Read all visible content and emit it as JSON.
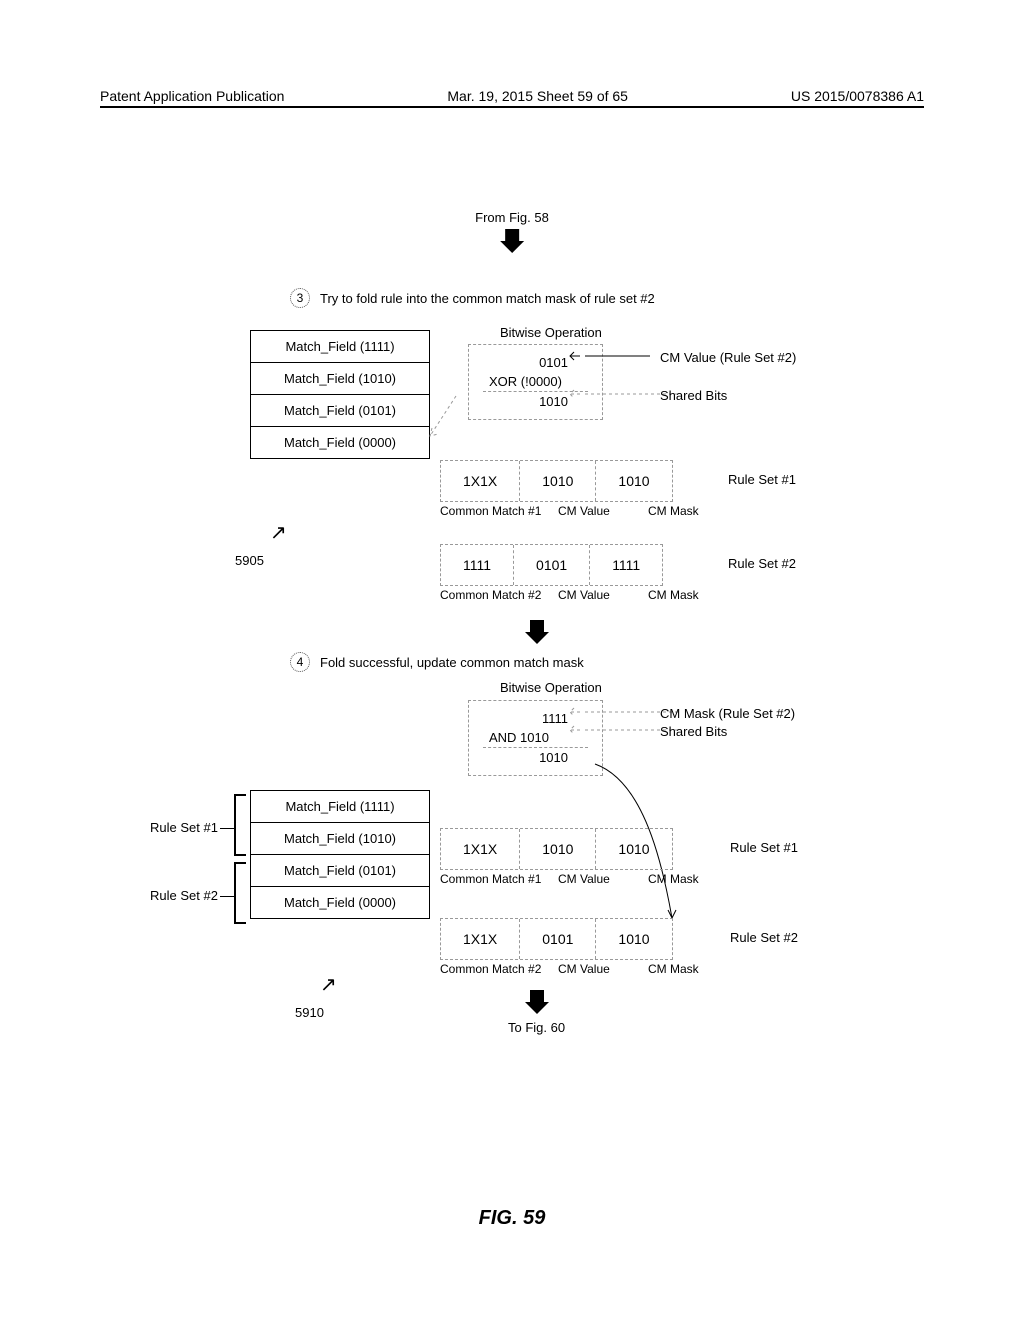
{
  "header": {
    "left": "Patent Application Publication",
    "mid": "Mar. 19, 2015  Sheet 59 of 65",
    "right": "US 2015/0078386 A1"
  },
  "from_label": "From Fig. 58",
  "step3": {
    "num": "3",
    "text": "Try to fold rule into the common match mask of rule set #2"
  },
  "step4": {
    "num": "4",
    "text": "Fold successful, update common match mask"
  },
  "match_fields_3": [
    "Match_Field (1111)",
    "Match_Field (1010)",
    "Match_Field (0101)",
    "Match_Field (0000)"
  ],
  "match_fields_4": [
    "Match_Field (1111)",
    "Match_Field (1010)",
    "Match_Field (0101)",
    "Match_Field (0000)"
  ],
  "bitop_title": "Bitwise Operation",
  "bitop3": {
    "line1": "0101",
    "op": "XOR (!0000)",
    "res": "1010",
    "note1": "CM Value (Rule Set #2)",
    "note2": "Shared Bits"
  },
  "bitop4": {
    "line1": "1111",
    "op": "AND 1010",
    "res": "1010",
    "note1": "CM Mask  (Rule Set #2)",
    "note2": "Shared Bits"
  },
  "sets3": {
    "row1": {
      "cm": "1X1X",
      "val": "1010",
      "mask": "1010",
      "label": "Rule Set #1"
    },
    "row2": {
      "cm": "1111",
      "val": "0101",
      "mask": "1111",
      "label": "Rule Set #2"
    },
    "head1": "Common Match #1",
    "head2": "Common Match #2",
    "col2": "CM Value",
    "col3": "CM Mask"
  },
  "sets4": {
    "row1": {
      "cm": "1X1X",
      "val": "1010",
      "mask": "1010",
      "label": "Rule Set #1"
    },
    "row2": {
      "cm": "1X1X",
      "val": "0101",
      "mask": "1010",
      "label": "Rule Set #2"
    },
    "head1": "Common Match #1",
    "head2": "Common Match #2",
    "col2": "CM Value",
    "col3": "CM Mask"
  },
  "rule_set_labels": {
    "rs1": "Rule Set #1",
    "rs2": "Rule Set #2"
  },
  "refs": {
    "r1": "5905",
    "r2": "5910"
  },
  "to_label": "To Fig. 60",
  "fig": "FIG. 59"
}
